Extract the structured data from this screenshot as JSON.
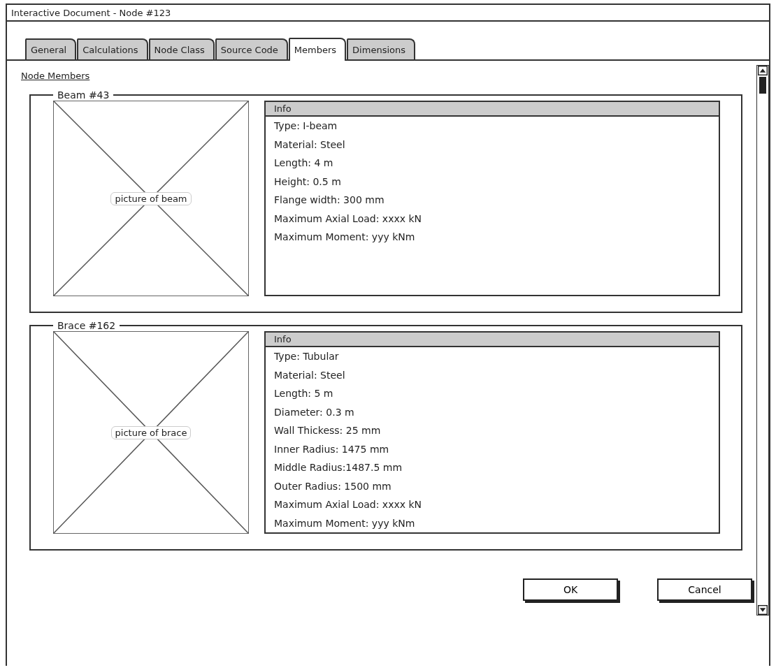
{
  "window": {
    "title": "Interactive Document - Node #123"
  },
  "tabs": [
    {
      "label": "General",
      "selected": false
    },
    {
      "label": "Calculations",
      "selected": false
    },
    {
      "label": "Node Class",
      "selected": false
    },
    {
      "label": "Source Code",
      "selected": false
    },
    {
      "label": "Members",
      "selected": true
    },
    {
      "label": "Dimensions",
      "selected": false
    }
  ],
  "section_link": "Node Members",
  "members": [
    {
      "title": "Beam #43",
      "picture_label": "picture of beam",
      "info_header": "Info",
      "info_lines": [
        "Type: I-beam",
        "Material: Steel",
        "Length: 4 m",
        "Height: 0.5 m",
        "Flange width: 300 mm",
        "Maximum Axial Load: xxxx kN",
        "Maximum Moment: yyy kNm"
      ]
    },
    {
      "title": "Brace #162",
      "picture_label": "picture of brace",
      "info_header": "Info",
      "info_lines": [
        "Type: Tubular",
        "Material: Steel",
        "Length: 5 m",
        "Diameter: 0.3 m",
        "Wall Thickess: 25 mm",
        "Inner Radius: 1475 mm",
        "Middle Radius:1487.5 mm",
        "Outer Radius: 1500 mm",
        "Maximum Axial Load: xxxx kN",
        "Maximum Moment: yyy kNm"
      ]
    }
  ],
  "buttons": [
    "OK",
    "Cancel"
  ]
}
